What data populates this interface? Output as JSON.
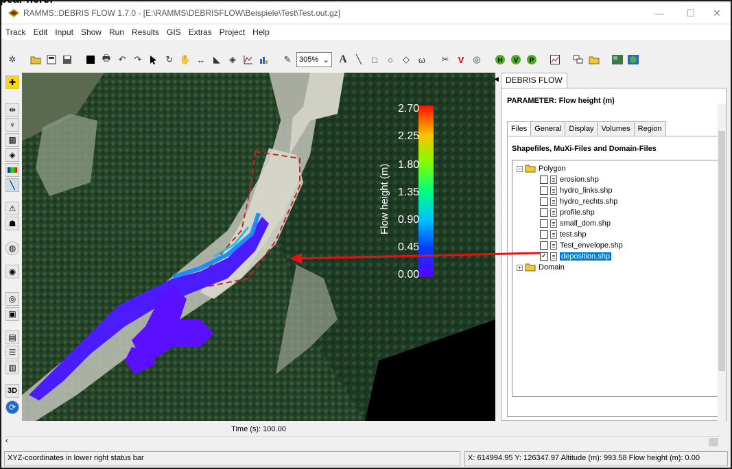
{
  "top_caption": "pear here:",
  "window": {
    "title": "RAMMS::DEBRIS FLOW 1.7.0  - [E:\\RAMMS\\DEBRISFLOW\\Beispiele\\Test\\Test.out.gz]",
    "minimize": "—",
    "maximize": "☐",
    "close": "✕"
  },
  "menu": [
    "Track",
    "Edit",
    "Input",
    "Show",
    "Run",
    "Results",
    "GIS",
    "Extras",
    "Project",
    "Help"
  ],
  "toolbar": {
    "zoom_value": "305%",
    "text_tool": "A"
  },
  "map": {
    "time_label": "Time (s): 100.00",
    "legend": {
      "title": "Flow height (m)",
      "ticks": [
        "2.70",
        "2.25",
        "1.80",
        "1.35",
        "0.90",
        "0.45",
        "0.00"
      ]
    }
  },
  "panel": {
    "tab": "DEBRIS FLOW",
    "parameter_title": "PARAMETER: Flow height (m)",
    "subtabs": [
      "Files",
      "General",
      "Display",
      "Volumes",
      "Region"
    ],
    "active_subtab": "Files",
    "heading": "Shapefiles, MuXi-Files and Domain-Files",
    "tree": {
      "root": "Polygon",
      "root_expander": "−",
      "files": [
        {
          "name": "erosion.shp",
          "checked": false
        },
        {
          "name": "hydro_links.shp",
          "checked": false
        },
        {
          "name": "hydro_rechts.shp",
          "checked": false
        },
        {
          "name": "profile.shp",
          "checked": false
        },
        {
          "name": "small_dom.shp",
          "checked": false
        },
        {
          "name": "test.shp",
          "checked": false
        },
        {
          "name": "Test_envelope.shp",
          "checked": false
        },
        {
          "name": "deposition.shp",
          "checked": true,
          "selected": true
        }
      ],
      "second_root": "Domain",
      "second_expander": "+"
    }
  },
  "status": {
    "left": "XYZ-coordinates in lower right status bar",
    "right": "X: 614994.95 Y: 126347.97 Altitude (m): 993.58 Flow height (m): 0.00"
  },
  "colors": {
    "arrow": "#e81010",
    "outline": "#cc2020",
    "selection": "#0078d7"
  }
}
